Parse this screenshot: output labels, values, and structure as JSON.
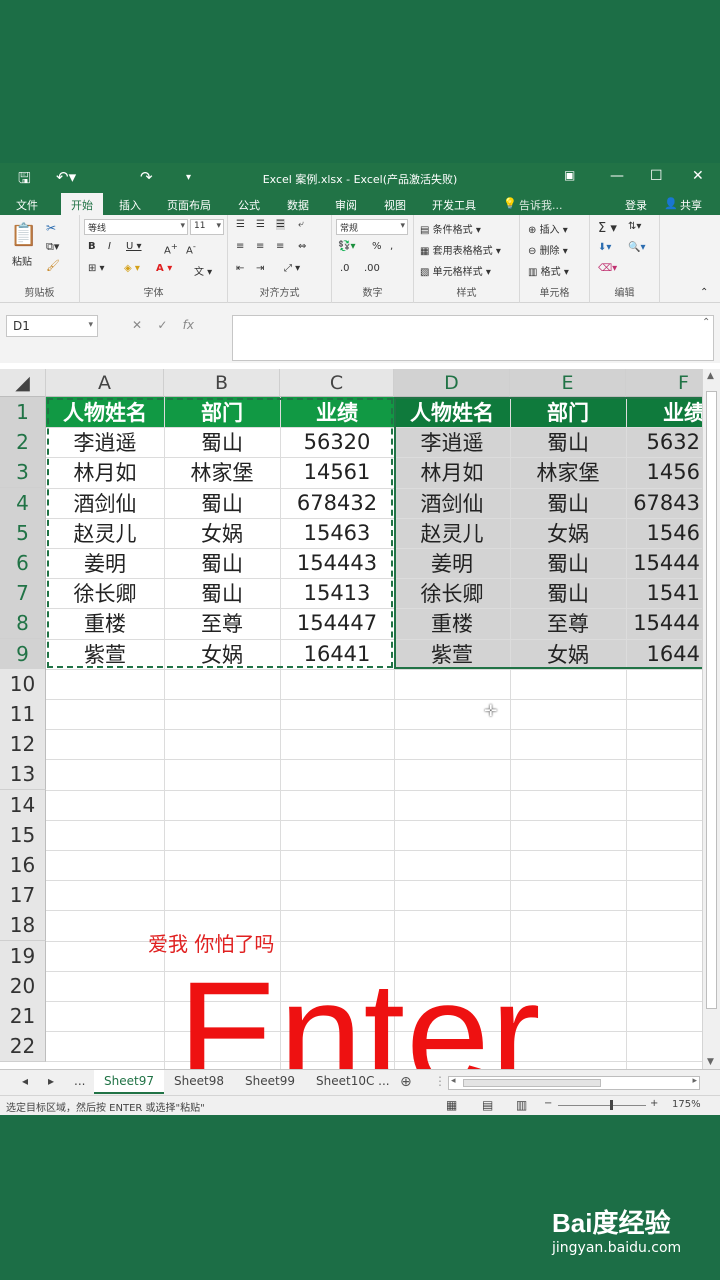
{
  "titlebar": {
    "title": "Excel 案例.xlsx - Excel(产品激活失败)"
  },
  "tabs": [
    "文件",
    "开始",
    "插入",
    "页面布局",
    "公式",
    "数据",
    "审阅",
    "视图",
    "开发工具"
  ],
  "tell_me": "告诉我...",
  "account": {
    "login": "登录",
    "share": "共享"
  },
  "ribbon": {
    "paste": "粘贴",
    "clipboard": "剪贴板",
    "font_name": "等线",
    "font_size": "11",
    "font_group": "字体",
    "align_group": "对齐方式",
    "number_format": "常规",
    "number_group": "数字",
    "cond_format": "条件格式",
    "table_format": "套用表格格式",
    "cell_style": "单元格样式",
    "style_group": "样式",
    "insert": "插入",
    "delete": "删除",
    "format": "格式",
    "cells_group": "单元格",
    "edit_group": "编辑"
  },
  "namebox": "D1",
  "columns": [
    "A",
    "B",
    "C",
    "D",
    "E",
    "F"
  ],
  "rows": [
    "1",
    "2",
    "3",
    "4",
    "5",
    "6",
    "7",
    "8",
    "9",
    "10",
    "11",
    "12",
    "13",
    "14",
    "15",
    "16",
    "17",
    "18",
    "19",
    "20",
    "21",
    "22"
  ],
  "table": {
    "header": [
      "人物姓名",
      "部门",
      "业绩"
    ],
    "rows": [
      [
        "李逍遥",
        "蜀山",
        "56320"
      ],
      [
        "林月如",
        "林家堡",
        "14561"
      ],
      [
        "酒剑仙",
        "蜀山",
        "678432"
      ],
      [
        "赵灵儿",
        "女娲",
        "15463"
      ],
      [
        "姜明",
        "蜀山",
        "154443"
      ],
      [
        "徐长卿",
        "蜀山",
        "15413"
      ],
      [
        "重楼",
        "至尊",
        "154447"
      ],
      [
        "紫萱",
        "女娲",
        "16441"
      ]
    ]
  },
  "copy_header": [
    "人物姓名",
    "部门",
    "业绩"
  ],
  "copy_rows": [
    [
      "李逍遥",
      "蜀山",
      "5632"
    ],
    [
      "林月如",
      "林家堡",
      "1456"
    ],
    [
      "酒剑仙",
      "蜀山",
      "67843"
    ],
    [
      "赵灵儿",
      "女娲",
      "1546"
    ],
    [
      "姜明",
      "蜀山",
      "15444"
    ],
    [
      "徐长卿",
      "蜀山",
      "1541"
    ],
    [
      "重楼",
      "至尊",
      "15444"
    ],
    [
      "紫萱",
      "女娲",
      "1644"
    ]
  ],
  "overlay_caption": "爱我 你怕了吗",
  "overlay_big": "Enter",
  "sheets": [
    "Sheet97",
    "Sheet98",
    "Sheet99",
    "Sheet10C ..."
  ],
  "sheet_nav": "...",
  "status_text": "选定目标区域，然后按 ENTER 或选择\"粘贴\"",
  "zoom": "175%",
  "watermark": {
    "brand": "Bai度经验",
    "url": "jingyan.baidu.com"
  },
  "colors": {
    "excel_green": "#217346",
    "header_fill": "#119944",
    "enter_red": "#ee1111"
  }
}
